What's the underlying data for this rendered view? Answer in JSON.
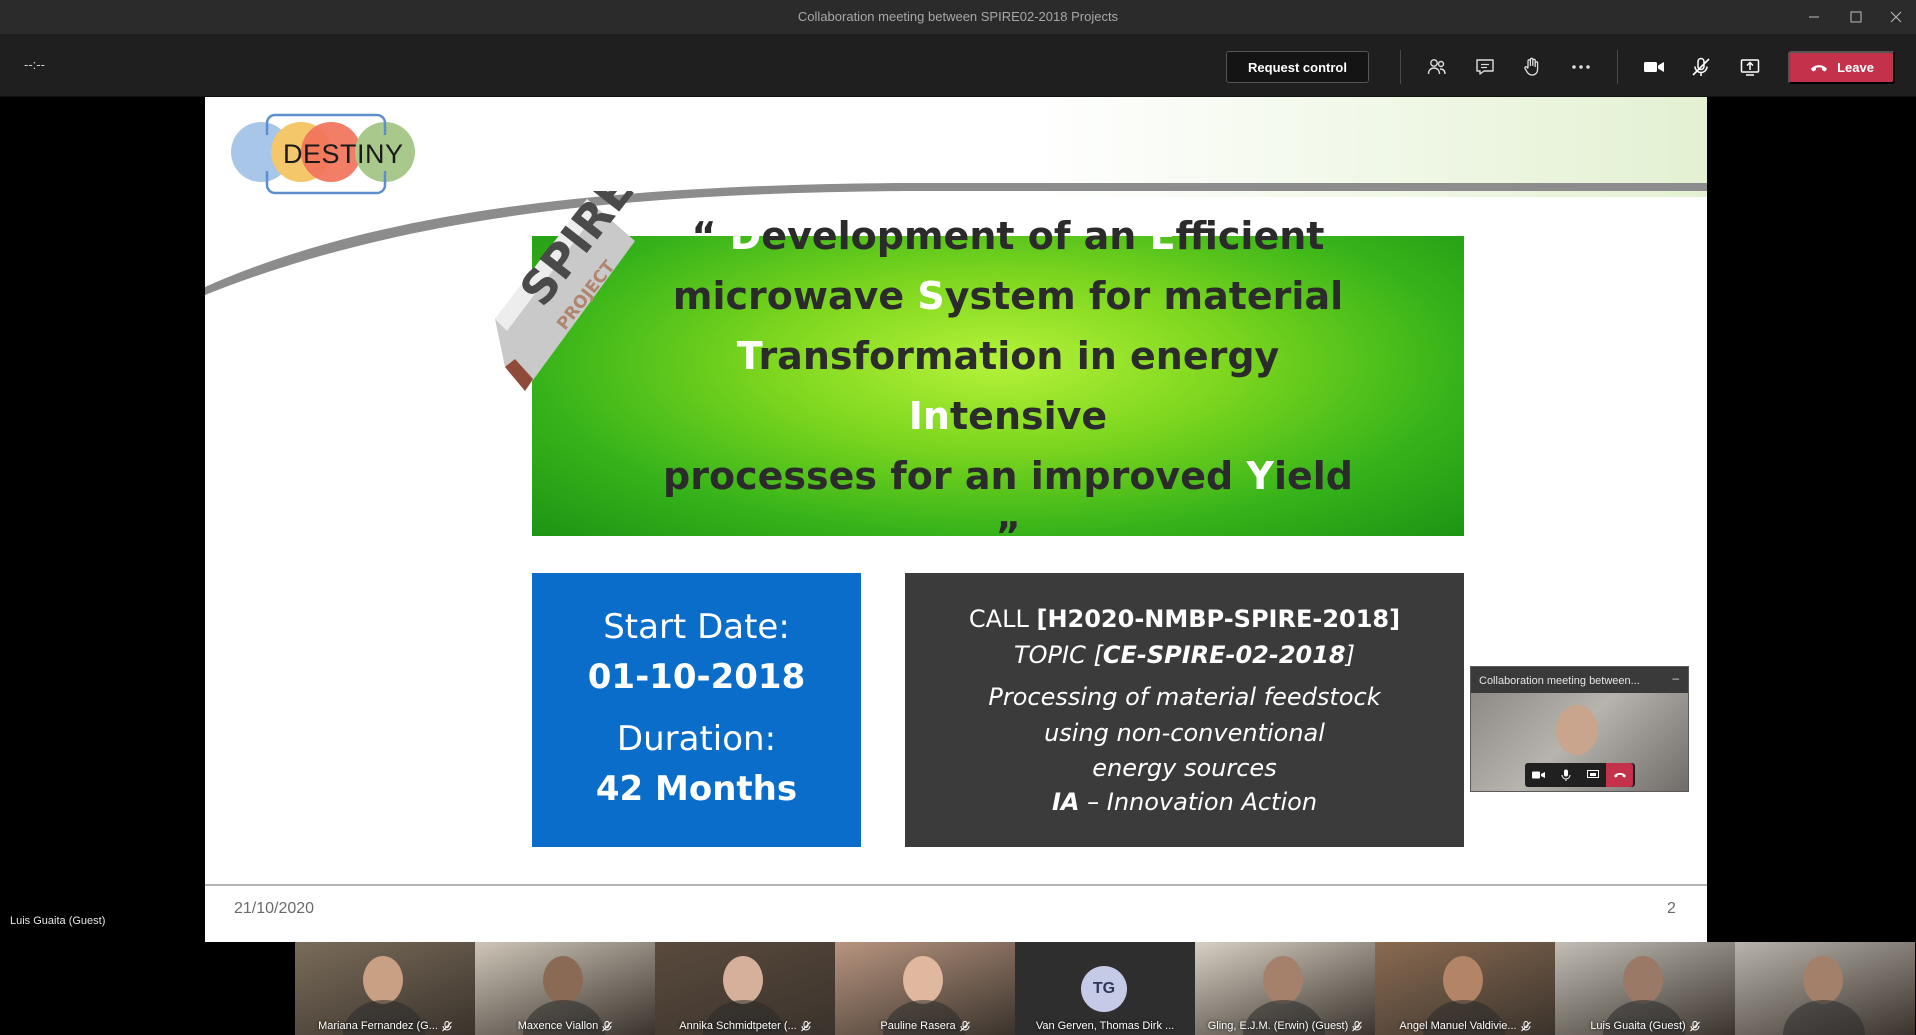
{
  "window": {
    "title": "Collaboration meeting between SPIRE02-2018 Projects"
  },
  "toolbar": {
    "timer": "--:--",
    "request_control": "Request control",
    "leave": "Leave",
    "icons": [
      "participants-icon",
      "chat-icon",
      "raise-hand-icon",
      "more-options-icon",
      "camera-icon",
      "mic-muted-icon",
      "share-tray-icon",
      "hang-up-icon"
    ]
  },
  "slide": {
    "logo_text": "DESTINY",
    "ribbon_word": "SPIRE",
    "ribbon_sub": "PROJECT",
    "title_lines": [
      [
        [
          "“ ",
          "n"
        ],
        [
          "D",
          "h"
        ],
        [
          "evelopment of an ",
          "n"
        ],
        [
          "E",
          "h"
        ],
        [
          "fficient",
          "n"
        ]
      ],
      [
        [
          "microwave ",
          "n"
        ],
        [
          "S",
          "h"
        ],
        [
          "ystem for material",
          "n"
        ]
      ],
      [
        [
          "T",
          "h"
        ],
        [
          "ransformation in energy ",
          "n"
        ],
        [
          "In",
          "h"
        ],
        [
          "tensive",
          "n"
        ]
      ],
      [
        [
          "processes for an improved ",
          "n"
        ],
        [
          "Y",
          "h"
        ],
        [
          "ield ”",
          "n"
        ]
      ]
    ],
    "start_label": "Start Date:",
    "start_value": "01-10-2018",
    "duration_label": "Duration:",
    "duration_value": "42 Months",
    "call_prefix": "CALL ",
    "call_value": "[H2020-NMBP-SPIRE-2018]",
    "topic_prefix": "TOPIC [",
    "topic_value": "CE-SPIRE-02-2018",
    "topic_suffix": "]",
    "desc_line1": "Processing of material feedstock",
    "desc_line2": "using non-conventional",
    "desc_line3": "energy sources",
    "ia_bold": "IA",
    "ia_rest": " – Innovation Action",
    "date": "21/10/2020",
    "page": "2",
    "colors": {
      "green": "#36b31a",
      "blue": "#0a6dc9",
      "dark": "#3b3b3b",
      "leave": "#c4314b"
    }
  },
  "mini_window": {
    "title": "Collaboration meeting between...",
    "close": "–"
  },
  "presenter": {
    "name": "Luis Guaita (Guest)"
  },
  "participants": [
    {
      "name": "Mariana Fernandez (G...",
      "muted": true,
      "bg": "#7a6c5a",
      "head": "#c9a084"
    },
    {
      "name": "Maxence Viallon",
      "muted": true,
      "bg": "#cfc6b9",
      "head": "#8a6a55"
    },
    {
      "name": "Annika Schmidtpeter (...",
      "muted": true,
      "bg": "#5a4a3d",
      "head": "#d6b09a"
    },
    {
      "name": "Pauline Rasera",
      "muted": true,
      "bg": "#b89580",
      "head": "#e0b8a0"
    },
    {
      "name": "Van Gerven, Thomas Dirk ...",
      "muted": false,
      "avatar": "TG"
    },
    {
      "name": "Gling, E.J.M. (Erwin) (Guest)",
      "muted": true,
      "bg": "#d8d0c4",
      "head": "#a5806a"
    },
    {
      "name": "Angel Manuel Valdivie...",
      "muted": true,
      "bg": "#8a6b52",
      "head": "#b48466"
    },
    {
      "name": "Luis Guaita (Guest)",
      "muted": true,
      "bg": "#c2beb6",
      "head": "#9a7a66"
    },
    {
      "name": "",
      "muted": false,
      "bg": "#b9b4ab",
      "head": "#a3806a"
    }
  ]
}
